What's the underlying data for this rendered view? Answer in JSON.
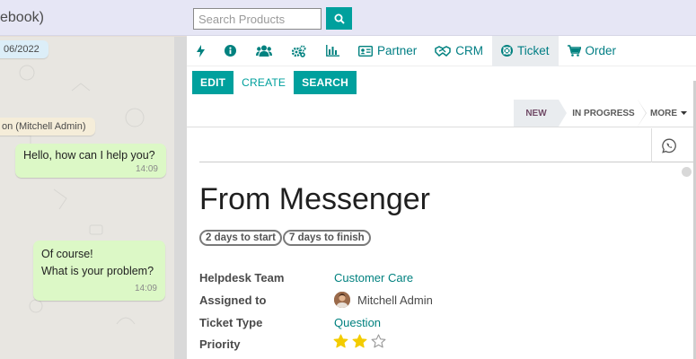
{
  "chat": {
    "header_title": "ebook)",
    "date_label": "06/2022",
    "system_label": "on (Mitchell Admin)",
    "messages": [
      {
        "lines": [
          "Hello, how can I help you?"
        ],
        "time": "14:09"
      },
      {
        "lines": [
          "Of course!",
          "What is your problem?"
        ],
        "time": "14:09"
      }
    ]
  },
  "search": {
    "placeholder": "Search Products"
  },
  "tabs": [
    {
      "icon": "bolt-icon"
    },
    {
      "icon": "info-icon"
    },
    {
      "icon": "users-icon"
    },
    {
      "icon": "cogs-icon"
    },
    {
      "icon": "bar-chart-icon"
    },
    {
      "icon": "id-card-icon",
      "label": "Partner"
    },
    {
      "icon": "handshake-icon",
      "label": "CRM"
    },
    {
      "icon": "life-ring-icon",
      "label": "Ticket",
      "active": true
    },
    {
      "icon": "cart-icon",
      "label": "Order"
    }
  ],
  "buttons": {
    "edit": "EDIT",
    "create": "CREATE",
    "search": "SEARCH"
  },
  "stages": {
    "new": "NEW",
    "in_progress": "IN PROGRESS",
    "more": "MORE"
  },
  "ticket": {
    "title": "From Messenger",
    "badges": [
      "2 days to start",
      "7 days to finish"
    ],
    "fields": {
      "helpdesk_team": {
        "label": "Helpdesk Team",
        "value": "Customer Care"
      },
      "assigned_to": {
        "label": "Assigned to",
        "value": "Mitchell Admin"
      },
      "ticket_type": {
        "label": "Ticket Type",
        "value": "Question"
      },
      "priority": {
        "label": "Priority",
        "rating": 2,
        "max": 3
      }
    }
  },
  "colors": {
    "accent": "#00a09d",
    "link": "#00817f",
    "chat_bubble": "#dcf8c6",
    "star_filled": "#f3cc00"
  }
}
